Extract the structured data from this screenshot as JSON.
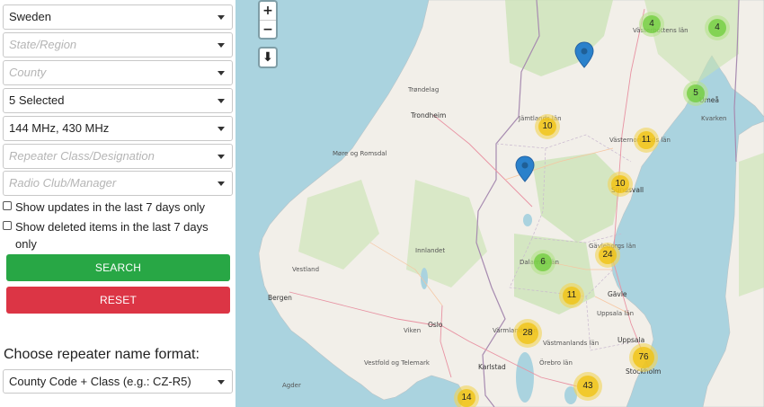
{
  "filters": {
    "country": "Sweden",
    "state_placeholder": "State/Region",
    "county_placeholder": "County",
    "status": "5 Selected",
    "bands": "144 MHz, 430 MHz",
    "class_placeholder": "Repeater Class/Designation",
    "club_placeholder": "Radio Club/Manager"
  },
  "checkboxes": {
    "updates_label": "Show updates in the last 7 days only",
    "deleted_label": "Show deleted items in the last 7 days only"
  },
  "buttons": {
    "search": "SEARCH",
    "reset": "RESET"
  },
  "name_format": {
    "label": "Choose repeater name format:",
    "value": "County Code + Class (e.g.: CZ-R5)"
  },
  "map_controls": {
    "zoom_in": "+",
    "zoom_out": "−",
    "download": "⬇"
  },
  "clusters": [
    "4",
    "4",
    "5",
    "10",
    "11",
    "10",
    "6",
    "24",
    "11",
    "28",
    "76",
    "43",
    "14"
  ],
  "places": {
    "trondheim": "Trondheim",
    "bergen": "Bergen",
    "oslo": "Oslo",
    "stockholm": "Stockholm",
    "uppsala": "Uppsala",
    "gavle": "Gävle",
    "karlstad": "Karlstad",
    "sundsvall": "Sundsvall",
    "umea": "Umeå",
    "jamtland": "Jämtlands län",
    "trondelag": "Trøndelag",
    "more_og_romsdal": "Møre og Romsdal",
    "vestland": "Vestland",
    "innlandet": "Innlandet",
    "viken": "Viken",
    "vestfold": "Vestfold og Telemark",
    "agder": "Agder",
    "varmland": "Värmlands län",
    "dalarna": "Dalarnas län",
    "gavleborg": "Gävleborgs län",
    "uppsala_lan": "Uppsala län",
    "vastmanland": "Västmanlands län",
    "orebro": "Örebro län",
    "vasternorrland": "Västernorrlands län",
    "vasterbotten": "Västerbottens län",
    "kvarken": "Kvarken"
  },
  "colors": {
    "sea": "#aad3df",
    "land": "#f2efe9",
    "forest": "#c8e2b0",
    "search_button": "#28a745",
    "reset_button": "#dc3545",
    "cluster_green": "#6ecc39",
    "cluster_yellow": "#f0c20c",
    "marker": "#2a81cb"
  }
}
